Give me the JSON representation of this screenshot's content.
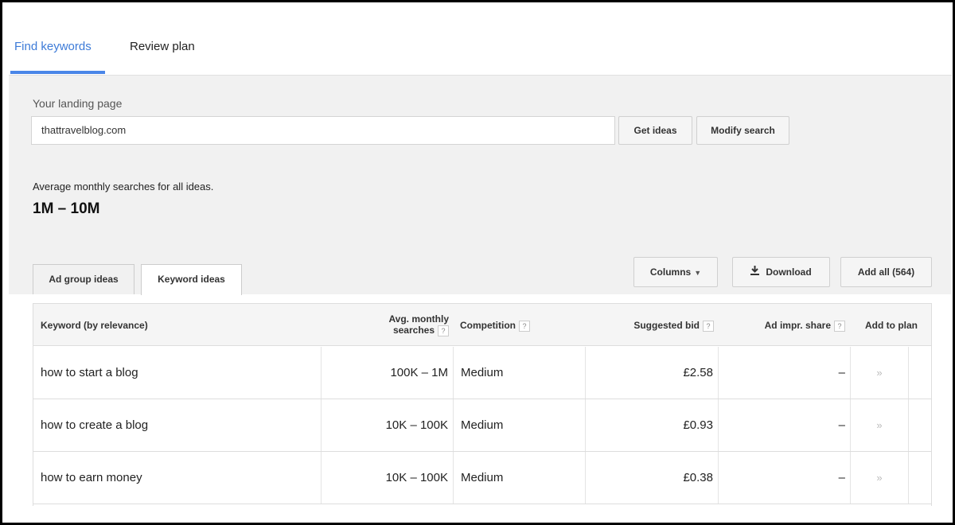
{
  "top_tabs": {
    "find_keywords": "Find keywords",
    "review_plan": "Review plan"
  },
  "landing": {
    "label": "Your landing page",
    "value": "thattravelblog.com",
    "get_ideas": "Get ideas",
    "modify_search": "Modify search"
  },
  "summary": {
    "label": "Average monthly searches for all ideas.",
    "value": "1M – 10M"
  },
  "sub_tabs": {
    "ad_group_ideas": "Ad group ideas",
    "keyword_ideas": "Keyword ideas"
  },
  "toolbar": {
    "columns": "Columns",
    "download": "Download",
    "add_all": "Add all (564)"
  },
  "table": {
    "headers": {
      "keyword": "Keyword (by relevance)",
      "avg_line1": "Avg. monthly",
      "avg_line2": "searches",
      "competition": "Competition",
      "suggested_bid": "Suggested bid",
      "ad_impr_share": "Ad impr. share",
      "add_to_plan": "Add to plan",
      "help_mark": "?"
    },
    "rows": [
      {
        "keyword": "how to start a blog",
        "avg": "100K – 1M",
        "competition": "Medium",
        "bid": "£2.58",
        "impr": "–",
        "add": "»"
      },
      {
        "keyword": "how to create a blog",
        "avg": "10K – 100K",
        "competition": "Medium",
        "bid": "£0.93",
        "impr": "–",
        "add": "»"
      },
      {
        "keyword": "how to earn money",
        "avg": "10K – 100K",
        "competition": "Medium",
        "bid": "£0.38",
        "impr": "–",
        "add": "»"
      }
    ]
  },
  "icons": {
    "download": "download-icon",
    "caret": "chevron-down-icon",
    "add": "double-chevron-right-icon"
  },
  "colors": {
    "accent": "#4a86e8",
    "tab_active_text": "#3d7bd8",
    "panel_bg": "#f1f1f1"
  }
}
